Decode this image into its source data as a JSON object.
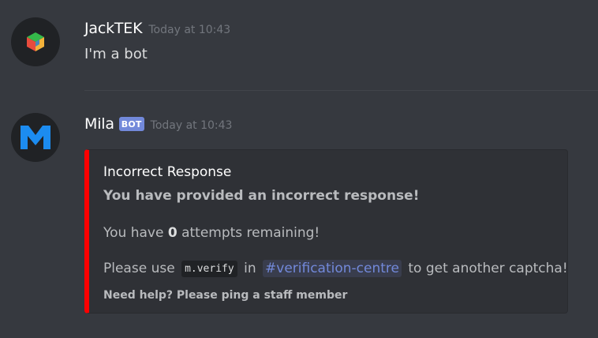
{
  "messages": [
    {
      "author": "JackTEK",
      "timestamp": "Today at 10:43",
      "text": "I'm a bot"
    },
    {
      "author": "Mila",
      "badge": "BOT",
      "timestamp": "Today at 10:43",
      "embed": {
        "accent_color": "#ff0000",
        "title": "Incorrect Response",
        "description_bold": "You have provided an incorrect response!",
        "attempts_prefix": "You have ",
        "attempts_count": "0",
        "attempts_suffix": " attempts remaining!",
        "please_prefix": "Please use",
        "command": "m.verify",
        "in_word": "in",
        "channel": "#verification-centre",
        "please_suffix": "to get another captcha!",
        "footer": "Need help? Please ping a staff member"
      }
    }
  ],
  "colors": {
    "background": "#36393f",
    "embed_background": "#2f3136",
    "bot_badge": "#7289da",
    "mention": "#7289da"
  },
  "icons": {
    "jack_avatar": "colorful-cube-icon",
    "mila_avatar": "m-logo-icon"
  }
}
